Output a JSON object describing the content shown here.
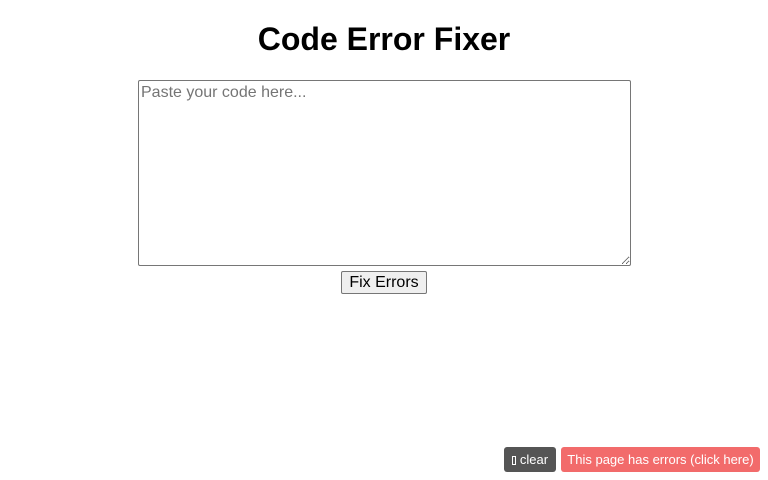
{
  "page": {
    "title": "Code Error Fixer"
  },
  "editor": {
    "placeholder": "Paste your code here...",
    "value": ""
  },
  "actions": {
    "fix_label": "Fix Errors"
  },
  "error_bar": {
    "clear_label": "clear",
    "clear_icon": "trash-icon",
    "errors_label": "This page has errors (click here)",
    "clear_bg": "#555555",
    "errors_bg": "#f26b6b"
  }
}
